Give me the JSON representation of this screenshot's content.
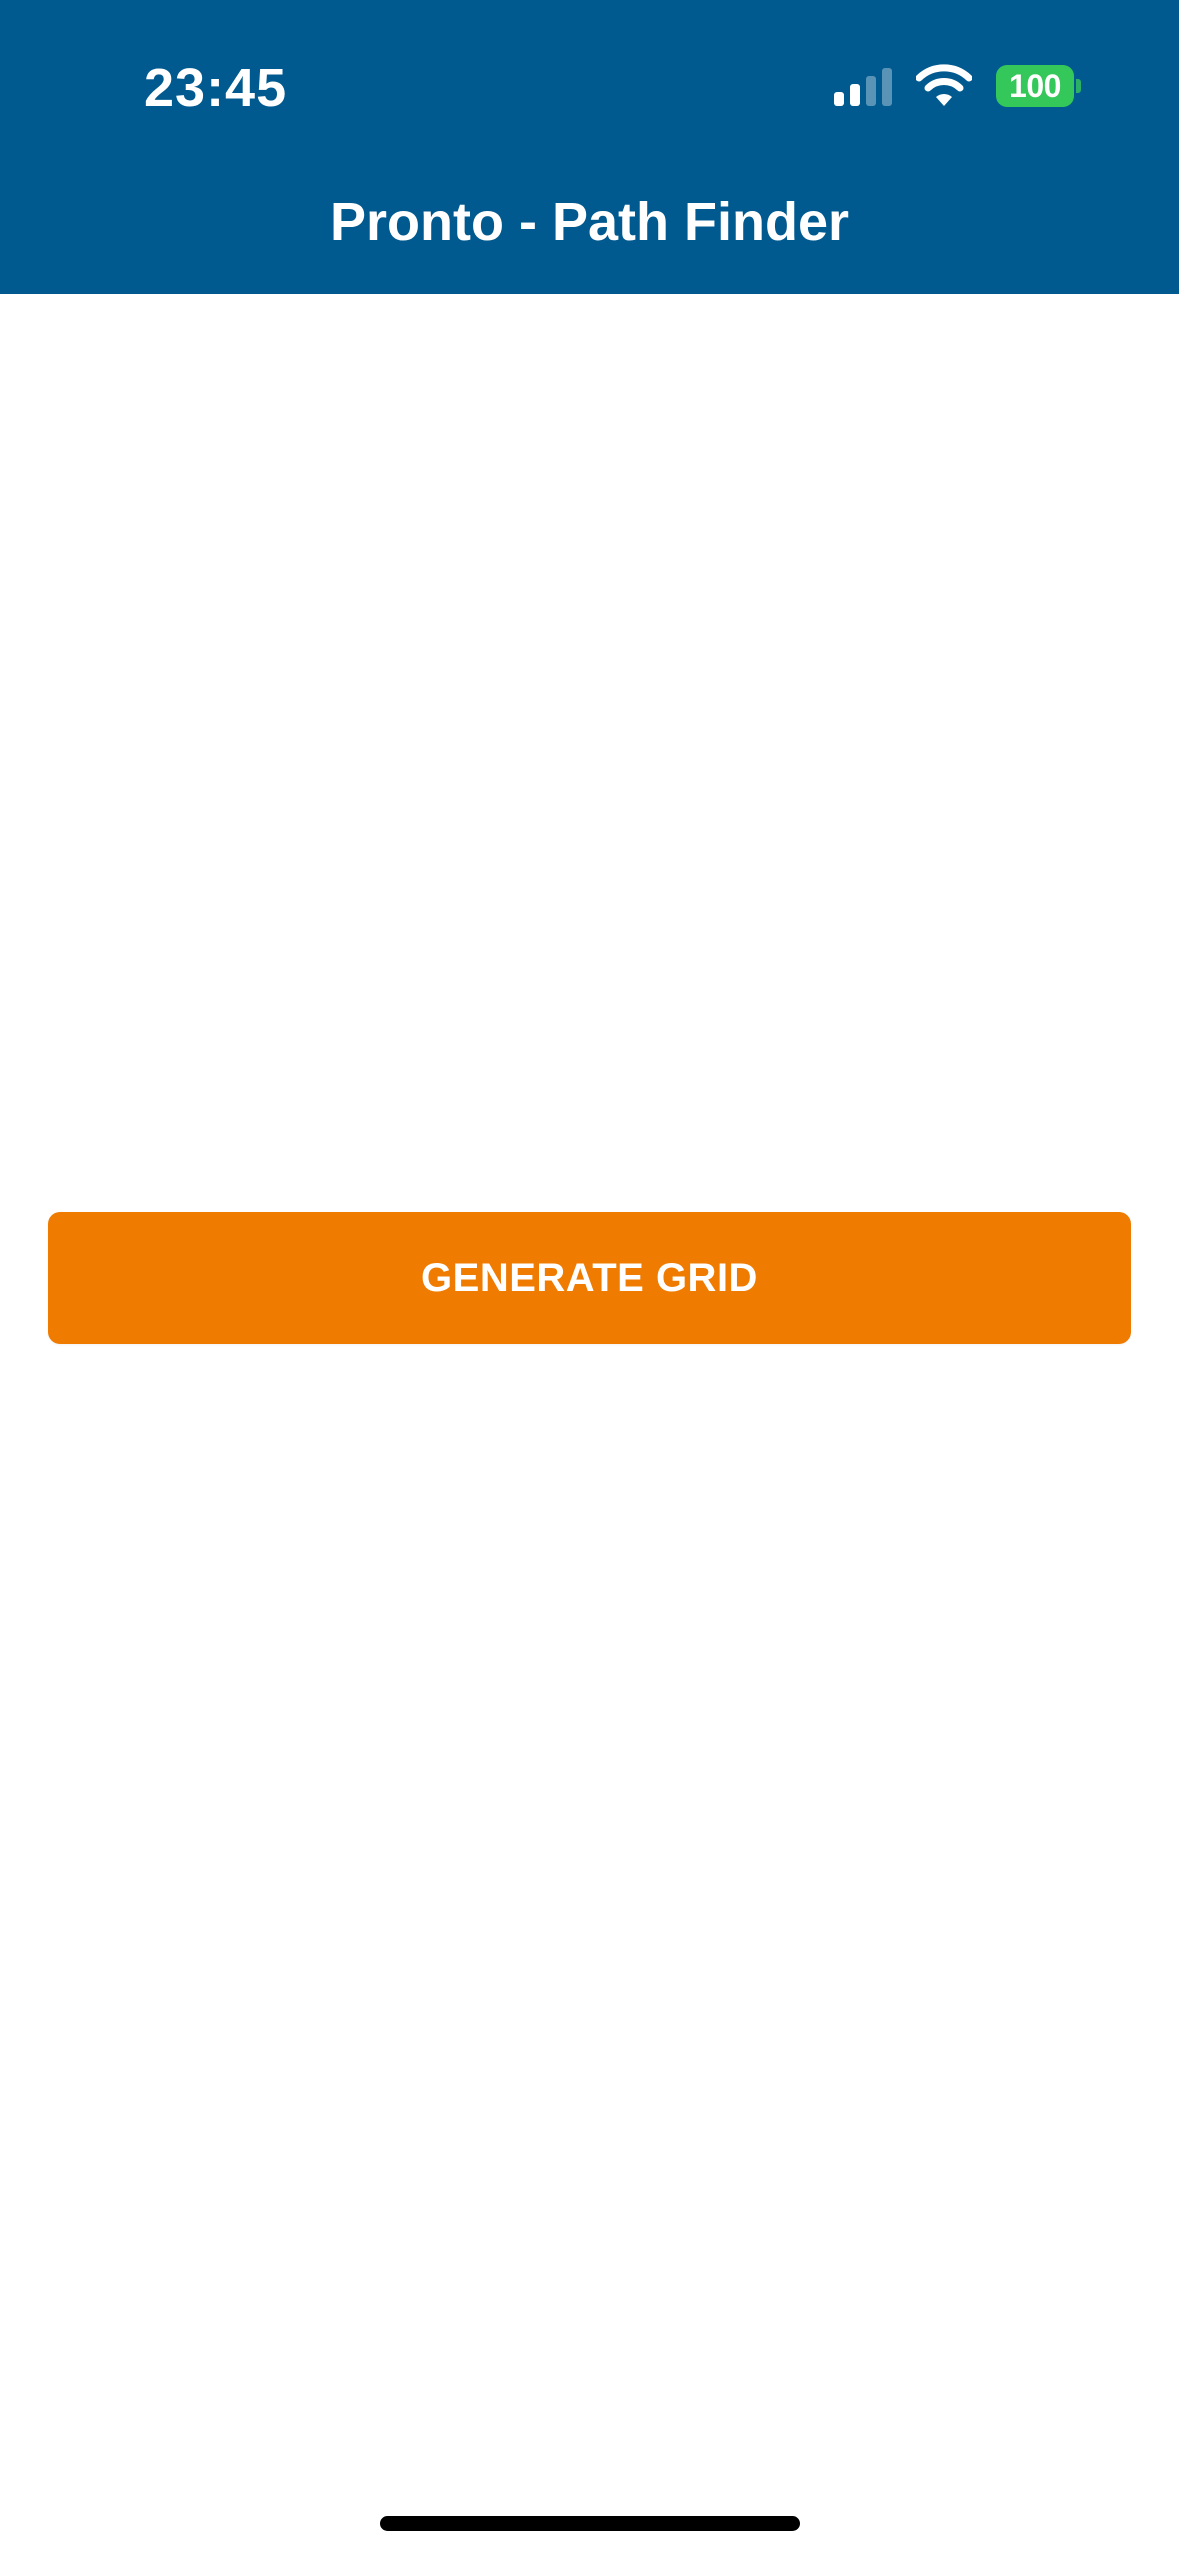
{
  "status_bar": {
    "time": "23:45",
    "battery_level": "100",
    "signal_strength": "2 of 4 bars",
    "icons": [
      "signal-icon",
      "wifi-icon",
      "battery-icon"
    ]
  },
  "header": {
    "title": "Pronto - Path Finder"
  },
  "main": {
    "generate_button_label": "GENERATE GRID"
  },
  "colors": {
    "header_bg": "#005A8F",
    "button_bg": "#EF7C00",
    "battery_green": "#34C759",
    "background": "#FFFFFF"
  }
}
